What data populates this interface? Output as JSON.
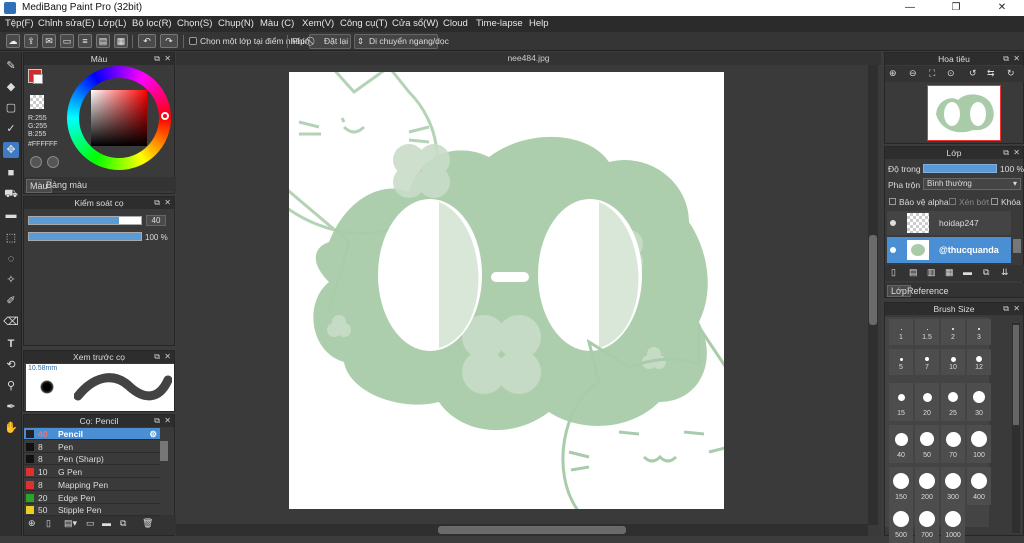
{
  "window": {
    "title": "MediBang Paint Pro (32bit)",
    "minimize": "—",
    "restore": "❐",
    "close": "✕"
  },
  "menu": [
    "Tệp(F)",
    "Chỉnh sửa(E)",
    "Lớp(L)",
    "Bộ lọc(R)",
    "Chọn(S)",
    "Chụp(N)",
    "Màu (C)",
    "Xem(V)",
    "Công cụ(T)",
    "Cửa sổ(W)",
    "Cloud",
    "Time-lapse",
    "Help"
  ],
  "toolbar": {
    "select_layer_checkbox_label": "Chọn một lớp tại điểm nhấp",
    "key_label": "Phím",
    "reset_label": "Đặt lại",
    "move_label": "Di chuyển ngang/dọc"
  },
  "color_panel": {
    "title": "Màu",
    "r": "R:255",
    "g": "G:255",
    "b": "B:255",
    "hex": "#FFFFFF",
    "tab_color": "Màu",
    "tab_palette": "Bảng màu",
    "fg_color": "#d42a2a",
    "bg_color": "#ffffff"
  },
  "brush_control": {
    "title": "Kiểm soát cọ",
    "size_value": "40",
    "opacity_value": "100 %",
    "size_fraction": 0.8,
    "opacity_fraction": 1.0
  },
  "brush_preview": {
    "title": "Xem trước cọ",
    "size_mm": "10.58mm"
  },
  "brush_list": {
    "title": "Cọ: Pencil",
    "items": [
      {
        "size": "40",
        "name": "Pencil",
        "color": "#222222",
        "selected": true
      },
      {
        "size": "8",
        "name": "Pen",
        "color": "#111111"
      },
      {
        "size": "8",
        "name": "Pen (Sharp)",
        "color": "#111111"
      },
      {
        "size": "10",
        "name": "G Pen",
        "color": "#e03030"
      },
      {
        "size": "8",
        "name": "Mapping Pen",
        "color": "#e03030"
      },
      {
        "size": "20",
        "name": "Edge Pen",
        "color": "#2aa52a"
      },
      {
        "size": "50",
        "name": "Stipple Pen",
        "color": "#e8d020"
      }
    ]
  },
  "canvas": {
    "filename": "nee484.jpg"
  },
  "navigator": {
    "title": "Hoa tiêu"
  },
  "layer_panel": {
    "title": "Lớp",
    "opacity_label": "Độ trong",
    "opacity_value": "100 %",
    "blend_label": "Pha trộn",
    "blend_value": "Bình thường",
    "protect_alpha": "Bảo vệ alpha",
    "clipping": "Xén bớt",
    "lock": "Khóa",
    "layers": [
      {
        "name": "hoidap247",
        "selected": false
      },
      {
        "name": "@thucquanda",
        "selected": true
      }
    ],
    "tab_layer": "Lớp",
    "tab_reference": "Reference"
  },
  "brush_size_panel": {
    "title": "Brush Size",
    "sizes": [
      "1",
      "1.5",
      "2",
      "3",
      "5",
      "7",
      "10",
      "12",
      "15",
      "20",
      "25",
      "30",
      "40",
      "50",
      "70",
      "100",
      "150",
      "200",
      "300",
      "400",
      "500",
      "700",
      "1000"
    ]
  }
}
